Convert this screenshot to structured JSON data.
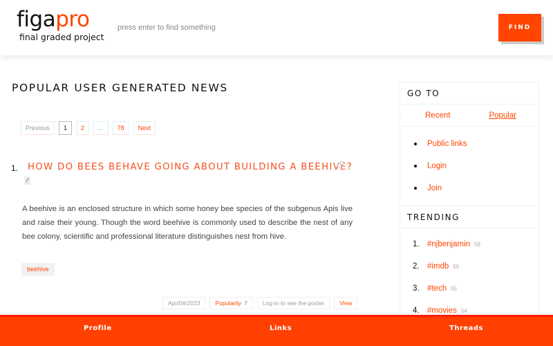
{
  "header": {
    "logo_main_a": "figa",
    "logo_main_b": "pro",
    "logo_sub": "final graded project",
    "search_placeholder": "press enter to find something",
    "find_label": "FIND"
  },
  "main": {
    "title": "POPULAR USER GENERATED NEWS",
    "pagination": [
      "Previous",
      "1",
      "2",
      "...",
      "78",
      "Next"
    ],
    "article": {
      "number": "1.",
      "title": "HOW DO BEES BEHAVE GOING ABOUT BUILDING A BEEHIVE?",
      "badge": "/",
      "description": "A beehive is an enclosed structure in which some honey bee species of the subgenus Apis live and raise their young. Though the word beehive is commonly used to describe the nest of any bee colony, scientific and professional literature distinguishes nest from hive.",
      "tag": "beehive",
      "date": "Apr/04/2023",
      "popularity_label": "Popularity",
      "popularity_value": "7",
      "poster": "Log-in to see the poster",
      "view_label": "View"
    }
  },
  "sidebar": {
    "goto_title": "GO TO",
    "tabs": [
      "Recent",
      "Popular"
    ],
    "links": [
      "Public links",
      "Login",
      "Join"
    ],
    "trending_title": "TRENDING",
    "trending": [
      {
        "num": "1.",
        "tag": "#njbenjamin",
        "count": "58"
      },
      {
        "num": "2.",
        "tag": "#imdb",
        "count": "55"
      },
      {
        "num": "3.",
        "tag": "#tech",
        "count": "55"
      },
      {
        "num": "4.",
        "tag": "#movies",
        "count": "54"
      }
    ]
  },
  "footer": {
    "items": [
      "Profile",
      "Links",
      "Threads"
    ]
  },
  "colors": {
    "accent": "#ff4500",
    "footer_bg": "#ff4000"
  }
}
